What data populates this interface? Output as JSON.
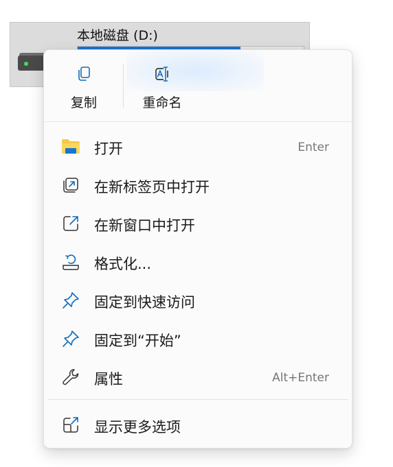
{
  "drive": {
    "name": "本地磁盘 (D:)",
    "usage_fraction": 0.72
  },
  "menu": {
    "quick_actions": [
      {
        "label": "复制",
        "icon": "copy-icon"
      },
      {
        "label": "重命名",
        "icon": "rename-icon"
      }
    ],
    "items": [
      {
        "label": "打开",
        "shortcut": "Enter",
        "icon": "folder-icon"
      },
      {
        "label": "在新标签页中打开",
        "shortcut": "",
        "icon": "open-new-tab-icon"
      },
      {
        "label": "在新窗口中打开",
        "shortcut": "",
        "icon": "open-new-window-icon"
      },
      {
        "label": "格式化...",
        "shortcut": "",
        "icon": "format-icon"
      },
      {
        "label": "固定到快速访问",
        "shortcut": "",
        "icon": "pin-icon"
      },
      {
        "label": "固定到“开始”",
        "shortcut": "",
        "icon": "pin-icon"
      },
      {
        "label": "属性",
        "shortcut": "Alt+Enter",
        "icon": "wrench-icon"
      },
      {
        "label": "显示更多选项",
        "shortcut": "",
        "icon": "show-more-icon"
      }
    ]
  },
  "colors": {
    "accent": "#0f6cbd",
    "folder_yellow": "#f7c948",
    "folder_blue": "#1a74d2",
    "drive_bar": "#1a74d2"
  }
}
